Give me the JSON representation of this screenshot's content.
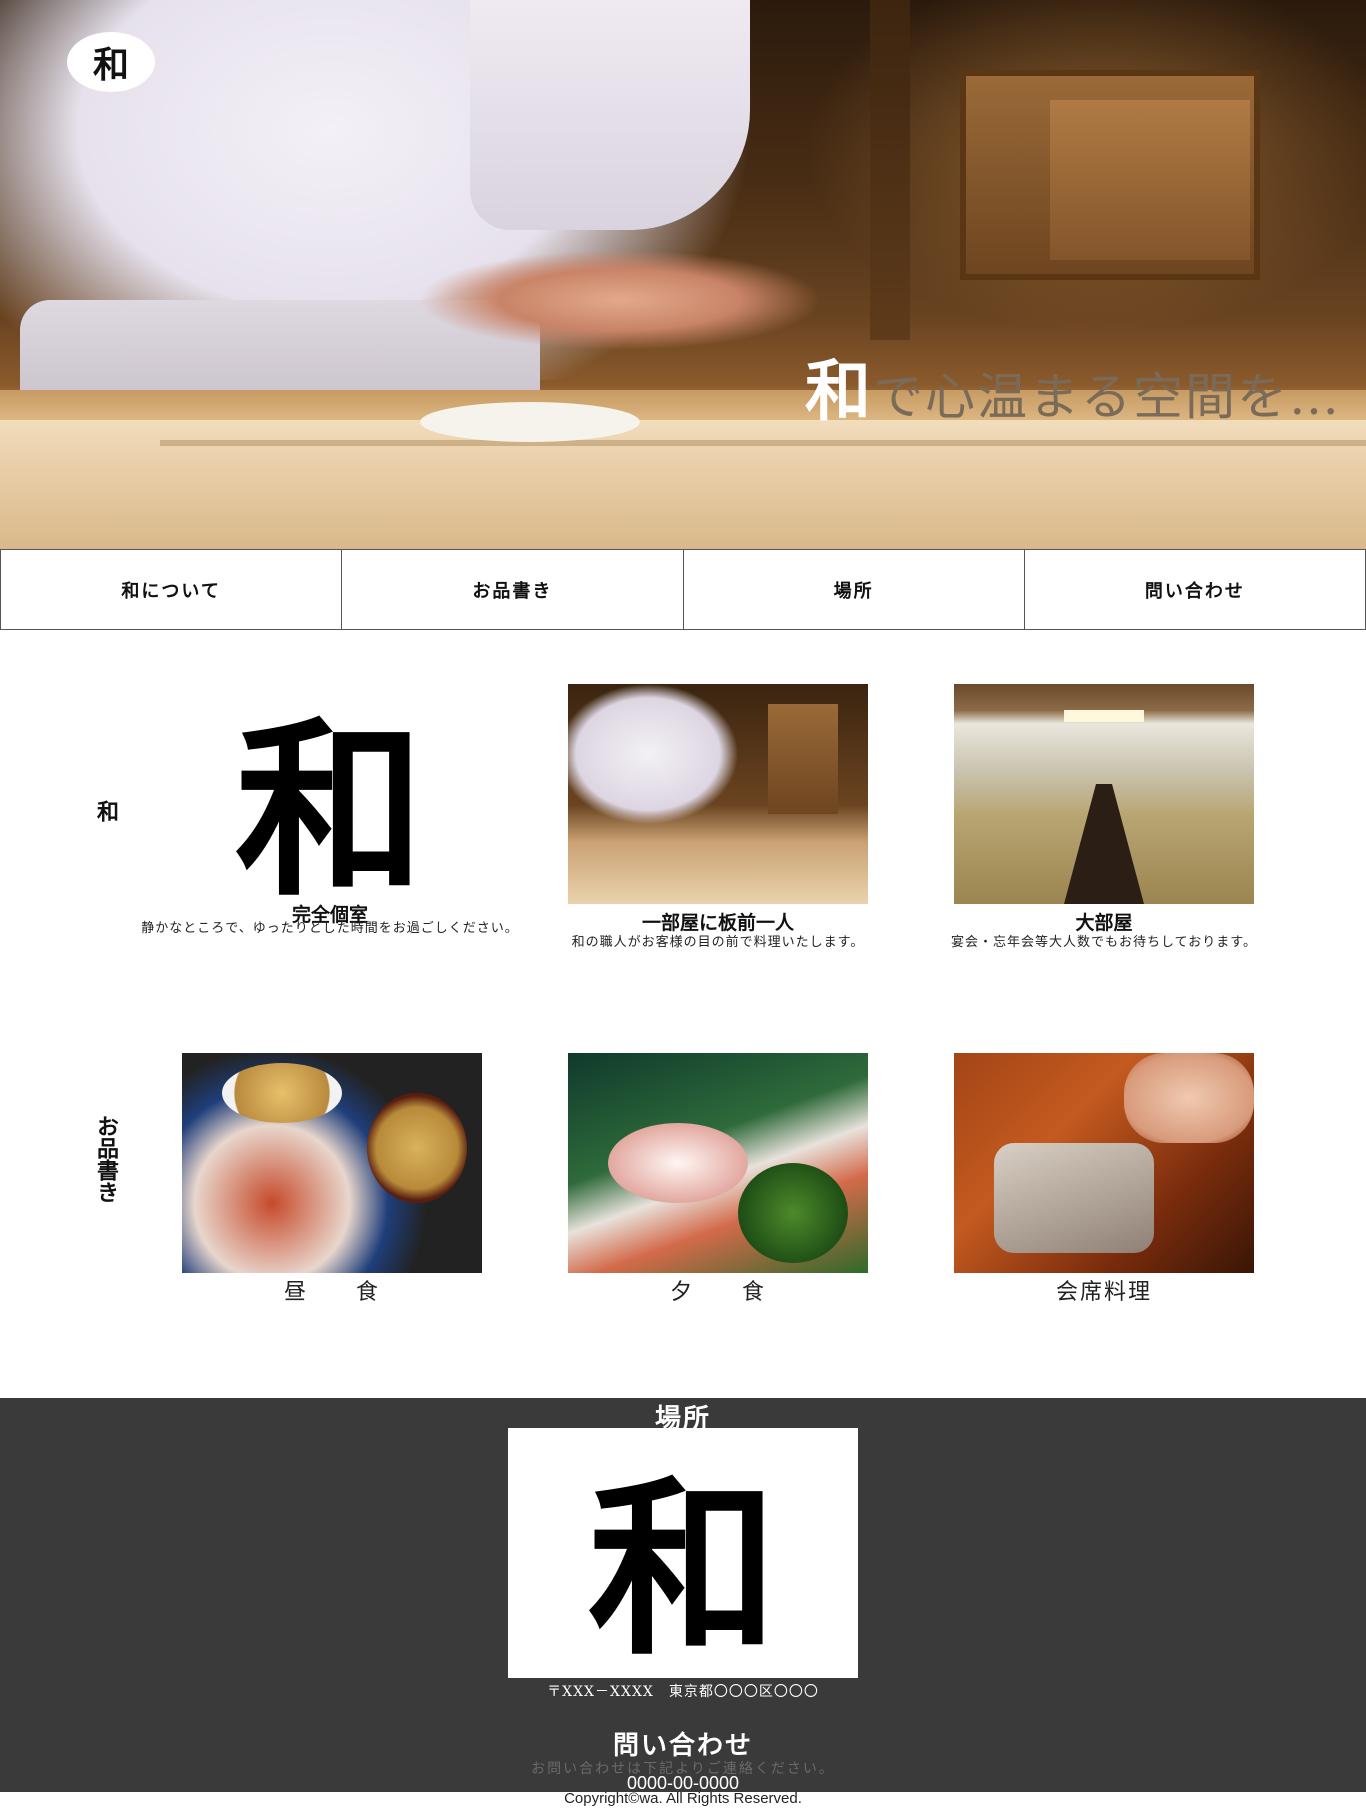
{
  "hero": {
    "logo_text": "和",
    "tagline_first": "和",
    "tagline_rest": "で心温まる空間を…"
  },
  "nav": {
    "items": [
      "和について",
      "お品書き",
      "場所",
      "問い合わせ"
    ]
  },
  "about": {
    "side_label": "和",
    "logo_kanji": "和",
    "cards": [
      {
        "title": "完全個室",
        "desc": "静かなところで、ゆったりとした時間をお過ごしください。"
      },
      {
        "title": "一部屋に板前一人",
        "desc": "和の職人がお客様の目の前で料理いたします。"
      },
      {
        "title": "大部屋",
        "desc": "宴会・忘年会等大人数でもお待ちしております。"
      }
    ]
  },
  "menu": {
    "side_label": "お品書き",
    "items": [
      "昼　　食",
      "夕　　食",
      "会席料理"
    ]
  },
  "location": {
    "title": "場所",
    "map_kanji": "和",
    "address": "〒XXX－XXXX　東京都〇〇〇区〇〇〇"
  },
  "contact": {
    "title": "問い合わせ",
    "subtitle": "お問い合わせは下記よりご連絡ください。",
    "phone": "0000-00-0000"
  },
  "footer": {
    "copyright": "Copyright©wa. All Rights Reserved."
  }
}
